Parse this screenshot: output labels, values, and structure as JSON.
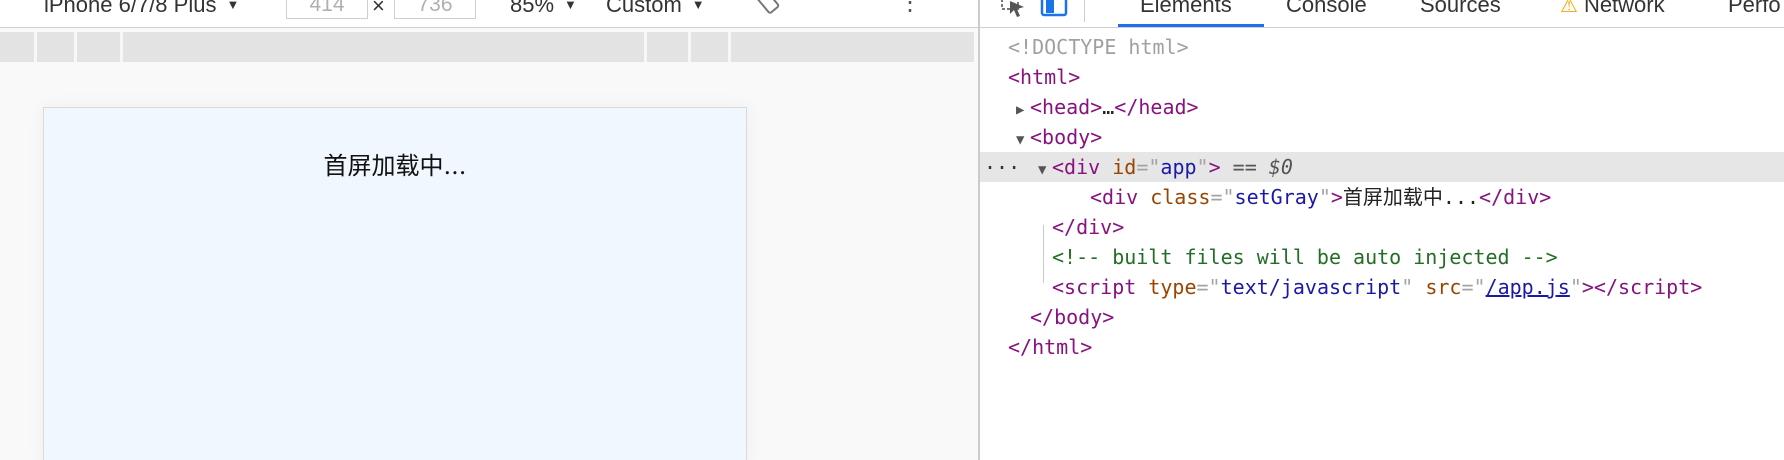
{
  "device_toolbar": {
    "device_name": "iPhone 6/7/8 Plus",
    "width_value": "414",
    "times": "×",
    "height_value": "736",
    "zoom": "85%",
    "throttle": "Custom"
  },
  "viewport": {
    "loading_text": "首屏加载中..."
  },
  "devtools": {
    "tabs": [
      "Elements",
      "Console",
      "Sources",
      "Network",
      "Perfo"
    ],
    "active_tab": "Elements",
    "network_warning_icon": "warning-triangle-icon",
    "dom_lines": {
      "doctype": "<!DOCTYPE html>",
      "html_open_tag": "<html>",
      "head_open": "<head>",
      "head_ellipsis": "…",
      "head_close": "</head>",
      "body_open": "<body>",
      "div_app_tag": "div",
      "div_app_attr": "id",
      "div_app_val": "app",
      "selected_marker": "== $0",
      "row_dots": "...",
      "div_gray_tag": "div",
      "div_gray_attr": "class",
      "div_gray_val": "setGray",
      "div_gray_text": "首屏加载中...",
      "div_close": "</div>",
      "comment": "<!-- built files will be auto injected -->",
      "script_tag": "script",
      "script_attr_type": "type",
      "script_type_val": "text/javascript",
      "script_attr_src": "src",
      "script_src_val": "/app.js",
      "body_close": "</body>",
      "html_close": "</html>"
    }
  },
  "colors": {
    "viewport_bg": "#f0f7ff",
    "tag": "#881280",
    "attr_name": "#994500",
    "attr_value": "#1a1aa6",
    "comment": "#236e25",
    "active_tab_underline": "#1a73e8",
    "selected_row": "#e6e6e6"
  }
}
